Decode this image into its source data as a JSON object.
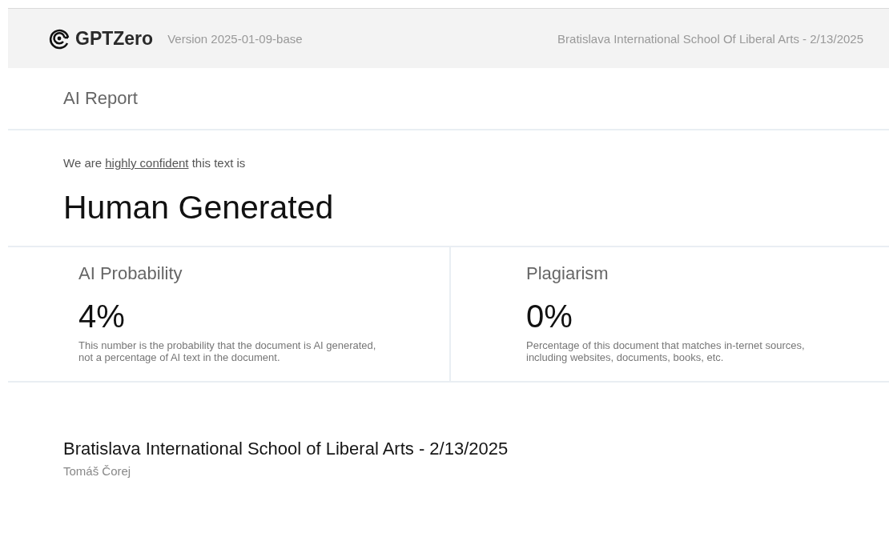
{
  "header": {
    "brand": "GPTZero",
    "version": "Version 2025-01-09-base",
    "school_date": "Bratislava International School Of Liberal Arts - 2/13/2025"
  },
  "report_title": "AI Report",
  "verdict": {
    "prefix": "We are ",
    "link": "highly confident",
    "suffix": " this text is",
    "result": "Human Generated"
  },
  "metrics": [
    {
      "title": "AI Probability",
      "value": "4%",
      "description": "This number is the probability that the document is AI generated, not a percentage of AI text in the document."
    },
    {
      "title": "Plagiarism",
      "value": "0%",
      "description": "Percentage of this document that matches in-ternet sources, including websites, documents, books, etc."
    }
  ],
  "document": {
    "title": "Bratislava International School of Liberal Arts - 2/13/2025",
    "author": "Tomáš Čorej"
  }
}
